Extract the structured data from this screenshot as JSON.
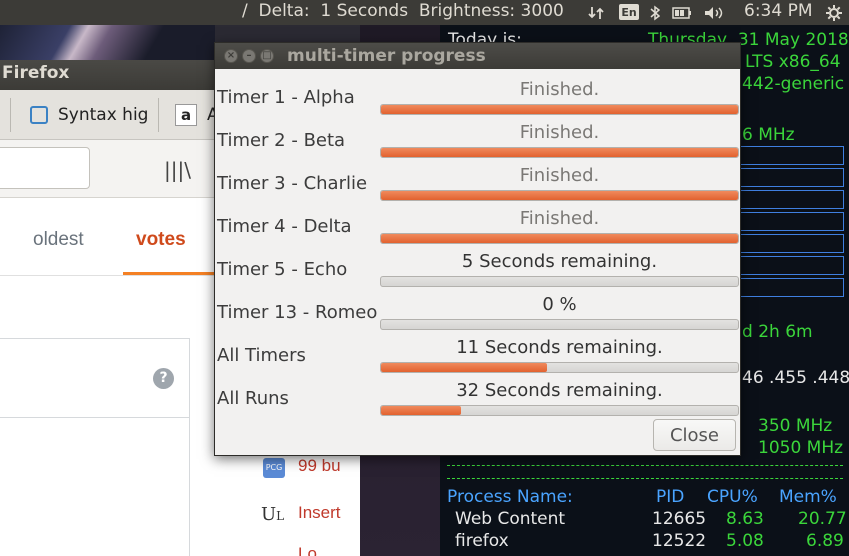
{
  "top_panel": {
    "status": "/  Delta:  1 Seconds  Brightness: 3000",
    "keyboard": "En",
    "time": "6:34 PM"
  },
  "firefox": {
    "title": "Firefox",
    "tabs": [
      "Syntax hig",
      "A"
    ],
    "sort_tabs": [
      "oldest",
      "votes"
    ],
    "sidebar_links": [
      "99 bu",
      "Insert",
      "Lo"
    ]
  },
  "conky": {
    "today_label": "Today is:",
    "date": "Thursday, 31 May 2018",
    "os": "LTS x86_64",
    "kernel": "442-generic",
    "cpu_freq": "6 MHz",
    "uptime": "d 2h 6m",
    "ip": "46 .455 .448",
    "gpu_freq1": "350 MHz",
    "gpu_freq2": "1050 MHz",
    "process_headers": [
      "Process Name:",
      "PID",
      "CPU%",
      "Mem%"
    ],
    "processes": [
      {
        "name": "Web Content",
        "pid": "12665",
        "cpu": "8.63",
        "mem": "20.77"
      },
      {
        "name": "firefox",
        "pid": "12522",
        "cpu": "5.08",
        "mem": "6.89"
      }
    ]
  },
  "dialog": {
    "title": "multi-timer progress",
    "close_label": "Close",
    "timers": [
      {
        "label": "Timer 1 - Alpha",
        "status": "Finished.",
        "progress": 1.0
      },
      {
        "label": "Timer 2 - Beta",
        "status": "Finished.",
        "progress": 1.0
      },
      {
        "label": "Timer 3 - Charlie",
        "status": "Finished.",
        "progress": 1.0
      },
      {
        "label": "Timer 4 - Delta",
        "status": "Finished.",
        "progress": 1.0
      },
      {
        "label": "Timer 5 - Echo",
        "status": "5 Seconds remaining.",
        "progress": 0.0
      },
      {
        "label": "Timer 13 - Romeo",
        "status": "0 %",
        "progress": 0.0
      },
      {
        "label": "All Timers",
        "status": "11 Seconds remaining.",
        "progress": 0.465
      },
      {
        "label": "All Runs",
        "status": "32 Seconds remaining.",
        "progress": 0.225
      }
    ]
  },
  "colors": {
    "progress_fill": "#e2622f",
    "conky_green": "#3bd63b",
    "conky_blue": "#4aa4ff"
  }
}
